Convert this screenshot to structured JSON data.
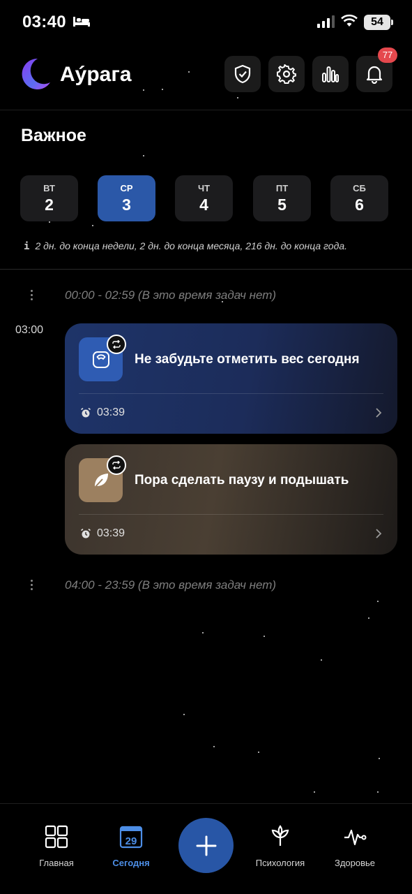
{
  "status_bar": {
    "time": "03:40",
    "battery": "54"
  },
  "header": {
    "app_name": "Аýрага",
    "notification_count": "77"
  },
  "section_title": "Важное",
  "days": [
    {
      "name": "ВТ",
      "num": "2",
      "active": false
    },
    {
      "name": "СР",
      "num": "3",
      "active": true
    },
    {
      "name": "ЧТ",
      "num": "4",
      "active": false
    },
    {
      "name": "ПТ",
      "num": "5",
      "active": false
    },
    {
      "name": "СБ",
      "num": "6",
      "active": false
    }
  ],
  "info_text": "2 дн. до конца недели, 2 дн. до конца месяца, 216 дн. до конца года.",
  "empty_slots": [
    "00:00 - 02:59 (В это время задач нет)",
    "04:00 - 23:59 (В это время задач нет)"
  ],
  "hour_label": "03:00",
  "tasks": [
    {
      "title": "Не забудьте отметить вес сегодня",
      "time": "03:39",
      "icon": "scale-icon",
      "color": "#2f5cb3"
    },
    {
      "title": "Пора сделать паузу и подышать",
      "time": "03:39",
      "icon": "leaf-icon",
      "color": "#9c8060"
    }
  ],
  "bottom_nav": {
    "home": "Главная",
    "today": "Сегодня",
    "today_date": "29",
    "psychology": "Психология",
    "health": "Здоровье"
  },
  "colors": {
    "accent": "#2b58a8",
    "badge": "#e5484d",
    "active_nav": "#4d8ee6"
  }
}
